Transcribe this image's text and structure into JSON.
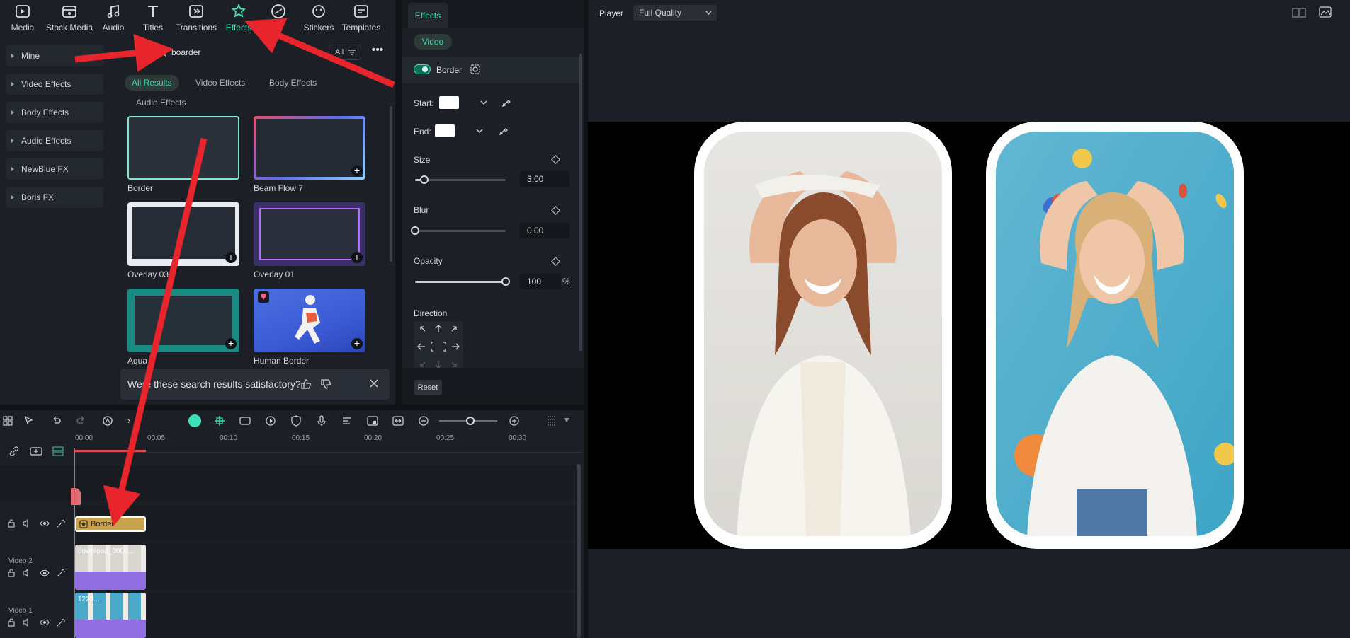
{
  "toolbar": {
    "items": [
      {
        "label": "Media",
        "icon": "media-icon"
      },
      {
        "label": "Stock Media",
        "icon": "stock-media-icon"
      },
      {
        "label": "Audio",
        "icon": "music-note-icon"
      },
      {
        "label": "Titles",
        "icon": "text-t-icon"
      },
      {
        "label": "Transitions",
        "icon": "transitions-icon"
      },
      {
        "label": "Effects",
        "icon": "effects-icon",
        "active": true
      },
      {
        "label": "",
        "icon": "filters-icon"
      },
      {
        "label": "Stickers",
        "icon": "stickers-icon"
      },
      {
        "label": "Templates",
        "icon": "templates-icon"
      }
    ]
  },
  "leftnav": {
    "items": [
      "Mine",
      "Video Effects",
      "Body Effects",
      "Audio Effects",
      "NewBlue FX",
      "Boris FX"
    ]
  },
  "browser": {
    "search_value": "boarder",
    "filter_label": "All",
    "chips": [
      "All Results",
      "Video Effects",
      "Body Effects",
      "Audio Effects"
    ],
    "results": [
      {
        "label": "Border"
      },
      {
        "label": "Beam Flow 7"
      },
      {
        "label": "Overlay 03"
      },
      {
        "label": "Overlay 01"
      },
      {
        "label": "Aqua"
      },
      {
        "label": "Human Border"
      }
    ],
    "feedback_text": "Were these search results satisfactory?"
  },
  "props": {
    "tab": "Effects",
    "subtab": "Video",
    "effect_name": "Border",
    "start_label": "Start:",
    "end_label": "End:",
    "size_label": "Size",
    "size_value": "3.00",
    "size_fraction": 0.1,
    "blur_label": "Blur",
    "blur_value": "0.00",
    "blur_fraction": 0.0,
    "opacity_label": "Opacity",
    "opacity_value": "100",
    "opacity_unit": "%",
    "opacity_fraction": 1.0,
    "direction_label": "Direction",
    "reset_label": "Reset"
  },
  "player": {
    "label": "Player",
    "quality": "Full Quality"
  },
  "timeline": {
    "ruler": [
      "00:00",
      "00:05",
      "00:10",
      "00:15",
      "00:20",
      "00:25",
      "00:30"
    ],
    "tracks": [
      {
        "name": "",
        "clip_label": "Border"
      },
      {
        "name": "Video 2",
        "clip_label": "download_0000..."
      },
      {
        "name": "Video 1",
        "clip_label": "1223..."
      }
    ]
  },
  "colors": {
    "accent": "#3fe0b9",
    "border_clip": "#c9a24f",
    "video_clip": "#8e6ee0",
    "annotation_arrow": "#e8252c"
  }
}
